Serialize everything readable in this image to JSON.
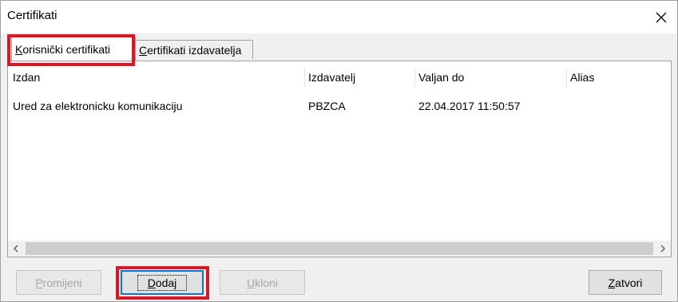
{
  "window": {
    "title": "Certifikati"
  },
  "tabs": [
    {
      "prefix": "",
      "hotkey": "K",
      "rest": "orisnički certifikati",
      "active": true
    },
    {
      "prefix": "",
      "hotkey": "C",
      "rest": "ertifikati izdavatelja",
      "active": false
    }
  ],
  "table": {
    "columns": [
      "Izdan",
      "Izdavatelj",
      "Valjan do",
      "Alias"
    ],
    "rows": [
      [
        "Ured za elektronicku komunikaciju",
        "PBZCA",
        "22.04.2017 11:50:57",
        ""
      ]
    ]
  },
  "buttons": {
    "change": {
      "hotkey": "P",
      "rest": "romijeni",
      "enabled": false
    },
    "add": {
      "hotkey": "D",
      "rest": "odaj",
      "enabled": true
    },
    "remove": {
      "hotkey": "U",
      "rest": "kloni",
      "enabled": false
    },
    "close": {
      "hotkey": "Z",
      "rest": "atvori",
      "enabled": true
    }
  },
  "colors": {
    "highlight": "#e0151f",
    "focus": "#0078d7"
  }
}
